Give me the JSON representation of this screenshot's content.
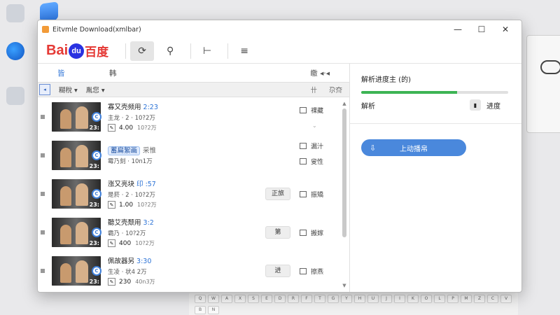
{
  "window": {
    "title": "Eitvmle Download(xmlbar)"
  },
  "window_controls": {
    "minimize": "—",
    "maximize": "☐",
    "close": "✕"
  },
  "toolbar": {
    "logo_text_1": "Bai",
    "logo_text_2": "du",
    "logo_text_3": "百度",
    "tools": [
      {
        "icon": "power-icon",
        "glyph": "⟳"
      },
      {
        "icon": "wrench-icon",
        "glyph": "⚲"
      },
      {
        "icon": "step-icon",
        "glyph": "⊢"
      },
      {
        "icon": "sliders-icon",
        "glyph": "≡"
      }
    ]
  },
  "left_panel": {
    "header": {
      "col1": "皆",
      "col2": "韩",
      "col3": "皦 ◂·◂"
    },
    "filter": {
      "selector": "◂",
      "item1": "糊稅 ▾",
      "item2": "胤您 ▾",
      "right": "卄 尕夼"
    },
    "rows": [
      {
        "duration": "23:",
        "title": "寡又壳频用",
        "size": "2:23",
        "subtitle": "主龙 · 2 · 10?2万",
        "number": "4.00",
        "small": "10?2万",
        "button": "",
        "action": "祼藏",
        "chev": "⌄"
      },
      {
        "duration": "23:",
        "title_highlight": "蓄扁絮画",
        "title_after": "采惟",
        "subtitle": "霉乃刻 · 10n1万",
        "number": "",
        "small": "",
        "button": "",
        "action": "漏汁",
        "action2": "叟性"
      },
      {
        "duration": "23:",
        "title": "涨又亮块",
        "size": "印 :57",
        "subtitle": "是菸 · 2 · 10?2万",
        "number": "1.00",
        "small": "10?2万",
        "button": "正旅",
        "action": "振矯"
      },
      {
        "duration": "23:",
        "title": "聽艾壳颓用",
        "size": "3:2",
        "subtitle": "霸乃 · 10?2万",
        "number": "400",
        "small": "10?2万",
        "button": "第",
        "action": "搬嫁"
      },
      {
        "duration": "23:",
        "title": "佩故器另",
        "size": "3:30",
        "subtitle": "生凌 · 状4 2万",
        "number": "230",
        "small": "40n3万",
        "button": "进",
        "action": "擦燕"
      }
    ],
    "scroll_up": "▲",
    "scroll_down": "▼"
  },
  "right_panel": {
    "title": "解析进度主 (的)",
    "progress": 0.65,
    "label": "解析",
    "right_icon": "▮",
    "right_label": "进度",
    "button_label": "上动播帛",
    "button_icon": "⇩"
  },
  "desktop": {
    "icon1": "",
    "icon2": "",
    "icon3": "",
    "keys": [
      "Q",
      "W",
      "A",
      "X",
      "S",
      "E",
      "D",
      "R",
      "F",
      "T",
      "G",
      "Y",
      "H",
      "U",
      "J",
      "I",
      "K",
      "O",
      "L",
      "P",
      "M",
      "Z",
      "C",
      "V",
      "B",
      "N"
    ]
  },
  "colors": {
    "accent": "#2b72d6",
    "progress": "#3db454",
    "primary_button": "#4a88dc",
    "logo_red": "#e53935",
    "logo_blue": "#2932e1"
  }
}
